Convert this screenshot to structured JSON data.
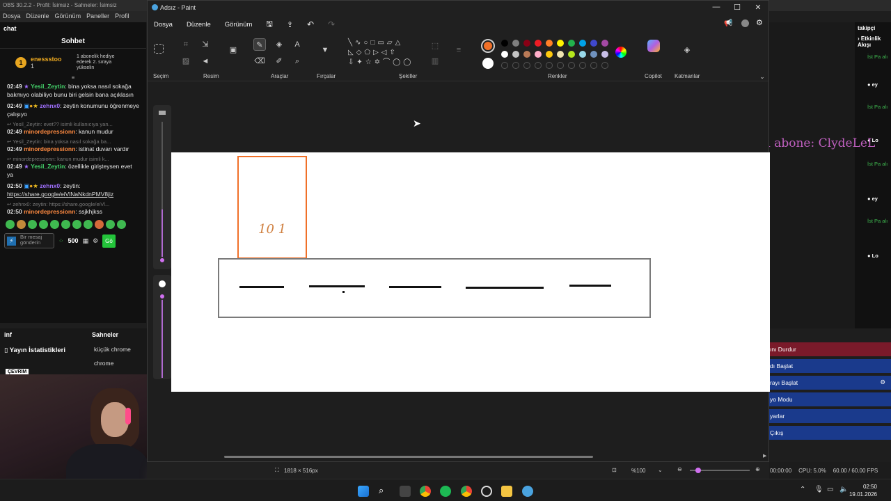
{
  "obs": {
    "title": "OBS 30.2.2 - Profil: İsimsiz - Sahneler: İsimsiz",
    "menu": [
      "Dosya",
      "Düzenle",
      "Görünüm",
      "Paneller",
      "Profil"
    ],
    "chat_dock_label": "chat",
    "chat": {
      "title": "Sohbet",
      "pinned": {
        "user": "enessstoo",
        "count": "1",
        "text": "1 abonelik hediye ederek 2. sıraya yükselin"
      },
      "messages": [
        {
          "time": "02:49",
          "user": "Yesil_Zeytin",
          "color": "green",
          "text": "bina yoksa nasıl sokağa bakmıyo olabiliyo bunu biri gelsin bana açıklasın"
        },
        {
          "time": "02:49",
          "user": "zehnx0",
          "color": "purple",
          "text": "zeytin konumunu öğrenmeye çalışıyo"
        },
        {
          "reply": "Yesil_Zeytin: evet?? isimli kullanıcıya yan...",
          "time": "02:49",
          "user": "minordepressionn",
          "color": "orange",
          "text": "kanun mudur"
        },
        {
          "time": "02:49",
          "user": "minordepressionn",
          "color": "orange",
          "text": "istinat duvarı vardır",
          "reply": "Yesil_Zeytin: bina yoksa nasıl sokağa ba..."
        },
        {
          "reply": "minordepressionn: kanun mudur isimli k...",
          "time": "02:49",
          "user": "Yesil_Zeytin",
          "color": "green",
          "text": "özellikle girişteysen evet ya"
        },
        {
          "time": "02:50",
          "user": "zehnx0",
          "color": "purple",
          "text": "zeytin:",
          "link": "https://share.google/eiVlNaNkdnPMV8jiz"
        },
        {
          "reply": "zehnx0: zeytin: https://share.google/eiVl...",
          "time": "02:50",
          "user": "minordepressionn",
          "color": "orange",
          "text": "ssjkhjkss"
        }
      ],
      "input_placeholder": "Bir mesaj gönderin",
      "points": "500",
      "send_label": "Gö"
    },
    "bottom": {
      "inf": "inf",
      "stats": "Yayın İstatistikleri",
      "scenes_title": "Sahneler",
      "scenes": [
        "küçük chrome",
        "chrome"
      ],
      "live_badge": "ÇEVRİM"
    },
    "right": {
      "title": "takipçi",
      "flow": "Etkinlik Akışı",
      "items": [
        "İst Pa alı",
        "ey",
        "İst Pa alı",
        "Lo",
        "İst Pa alı",
        "ey",
        "İst Pa alı",
        "Lo"
      ]
    },
    "son_abone": "Son abone: ClydeLeL",
    "controls": [
      "ını Durdur",
      "dı Başlat",
      "rayı Başlat",
      "yo Modu",
      "yarlar",
      "Çıkış"
    ],
    "status": {
      "time": "00:00:00",
      "cpu": "CPU: 5.0%",
      "fps": "60.00 / 60.00 FPS"
    }
  },
  "paint": {
    "title": "Adsız - Paint",
    "menu": [
      "Dosya",
      "Düzenle",
      "Görünüm"
    ],
    "groups": {
      "select": "Seçim",
      "image": "Resim",
      "tools": "Araçlar",
      "brushes": "Fırçalar",
      "shapes": "Şekiller",
      "colors": "Renkler",
      "copilot": "Copilot",
      "layers": "Katmanlar"
    },
    "palette_colors": [
      "#000000",
      "#7f7f7f",
      "#880015",
      "#ed1c24",
      "#ff7f27",
      "#fff200",
      "#22b14c",
      "#00a2e8",
      "#3f48cc",
      "#a349a4",
      "#ffffff",
      "#c3c3c3",
      "#b97a57",
      "#ffaec9",
      "#ffc90e",
      "#efe4b0",
      "#b5e61d",
      "#99d9ea",
      "#7092be",
      "#c8bfe7"
    ],
    "primary_color": "#f07028",
    "secondary_color": "#ffffff",
    "canvas_text": "10 1",
    "canvas_size": "1818 × 516px",
    "zoom": "%100"
  },
  "taskbar": {
    "time": "02:50",
    "date": "19.01.2026"
  }
}
